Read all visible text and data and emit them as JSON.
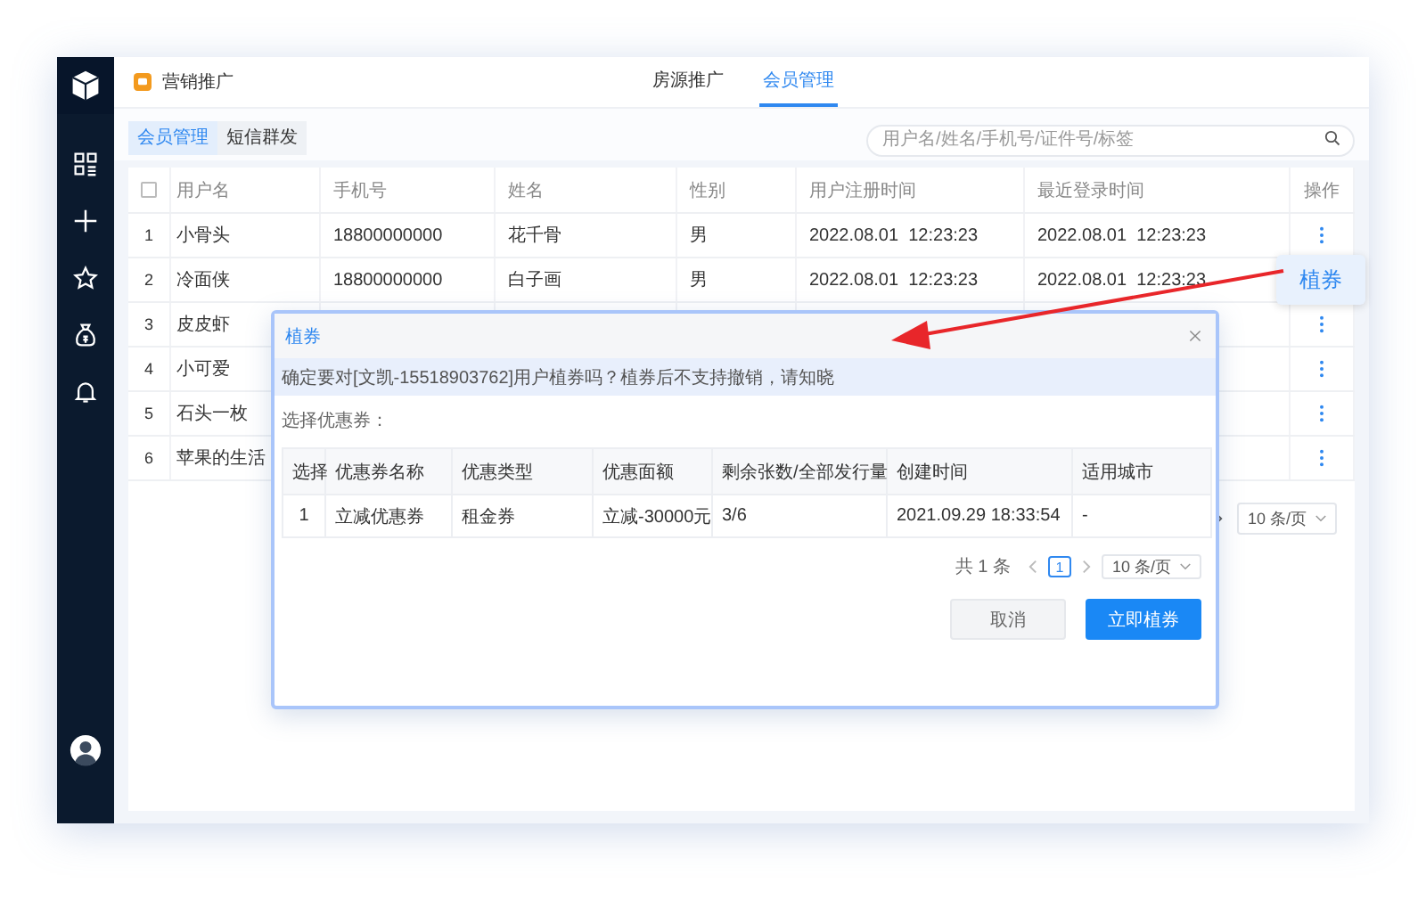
{
  "app": {
    "title": "营销推广"
  },
  "top_tabs": [
    {
      "label": "房源推广",
      "selected": false
    },
    {
      "label": "会员管理",
      "selected": true
    }
  ],
  "sub_tabs": [
    {
      "label": "会员管理",
      "selected": true
    },
    {
      "label": "短信群发",
      "selected": false
    }
  ],
  "search": {
    "placeholder": "用户名/姓名/手机号/证件号/标签"
  },
  "table": {
    "select_all": {
      "checked": false
    },
    "columns": [
      "用户名",
      "手机号",
      "姓名",
      "性别",
      "用户注册时间",
      "最近登录时间",
      "操作"
    ],
    "rows": [
      {
        "index": "1",
        "cells": [
          "小骨头",
          "18800000000",
          "花千骨",
          "男",
          "2022.08.01  12:23:23",
          "2022.08.01  12:23:23"
        ],
        "menu_open": false
      },
      {
        "index": "2",
        "cells": [
          "冷面侠",
          "18800000000",
          "白子画",
          "男",
          "2022.08.01  12:23:23",
          "2022.08.01  12:23:23"
        ],
        "menu_open": true
      },
      {
        "index": "3",
        "cells": [
          "皮皮虾"
        ],
        "menu_open": false
      },
      {
        "index": "4",
        "cells": [
          "小可爱"
        ],
        "menu_open": false
      },
      {
        "index": "5",
        "cells": [
          "石头一枚"
        ],
        "menu_open": false
      },
      {
        "index": "6",
        "cells": [
          "苹果的生活"
        ],
        "menu_open": false
      }
    ],
    "pagination": {
      "page_size": "10 条/页"
    }
  },
  "popover": {
    "label": "植券"
  },
  "dialog": {
    "title": "植券",
    "notice": "确定要对[文凯-15518903762]用户植券吗？植券后不支持撤销，请知晓",
    "prompt": "选择优惠券：",
    "table": {
      "columns": [
        "选择",
        "优惠券名称",
        "优惠类型",
        "优惠面额",
        "剩余张数/全部发行量",
        "创建时间",
        "适用城市"
      ],
      "rows": [
        {
          "cells": [
            "1",
            "立减优惠券",
            "租金券",
            "立减-30000元",
            "3/6",
            "2021.09.29 18:33:54",
            "-"
          ]
        }
      ]
    },
    "pagination": {
      "total": "共 1 条",
      "pages": [
        {
          "label": "1",
          "selected": true
        }
      ],
      "page_size": "10 条/页"
    },
    "buttons": [
      {
        "label": "取消",
        "kind": "secondary"
      },
      {
        "label": "立即植券",
        "kind": "primary"
      }
    ]
  }
}
